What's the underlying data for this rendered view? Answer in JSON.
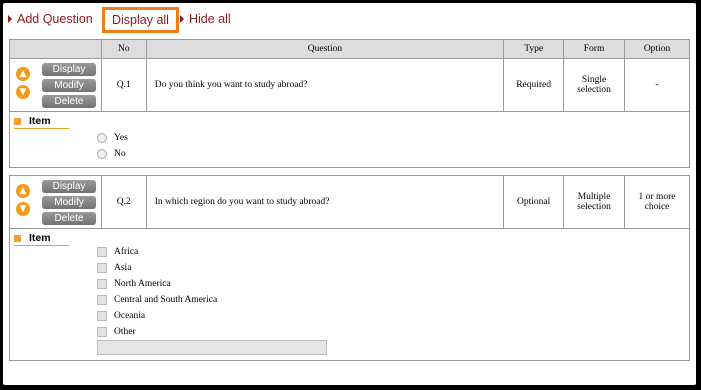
{
  "actions": {
    "add_question": "Add Question",
    "display_all": "Display all",
    "hide_all": "Hide all"
  },
  "table": {
    "headers": {
      "no": "No",
      "question": "Question",
      "type": "Type",
      "form": "Form",
      "option": "Option"
    }
  },
  "buttons": {
    "display": "Display",
    "modify": "Modify",
    "delete": "Delete"
  },
  "icons": {
    "up": "up-arrow-icon",
    "down": "down-arrow-icon",
    "accent": "#f29b1d",
    "highlight": "#f07d1a",
    "brand": "#8b1a1a"
  },
  "questions": [
    {
      "no": "Q.1",
      "question": "Do you think you want to study abroad?",
      "type": "Required",
      "form": "Single selection",
      "option": "-",
      "item_label": "Item",
      "items": [
        "Yes",
        "No"
      ]
    },
    {
      "no": "Q.2",
      "question": "In which region do you want to study abroad?",
      "type": "Optional",
      "form": "Multiple selection",
      "option": "1 or more choice",
      "item_label": "Item",
      "items": [
        "Africa",
        "Asia",
        "North America",
        "Central and South America",
        "Oceania",
        "Other"
      ]
    }
  ]
}
